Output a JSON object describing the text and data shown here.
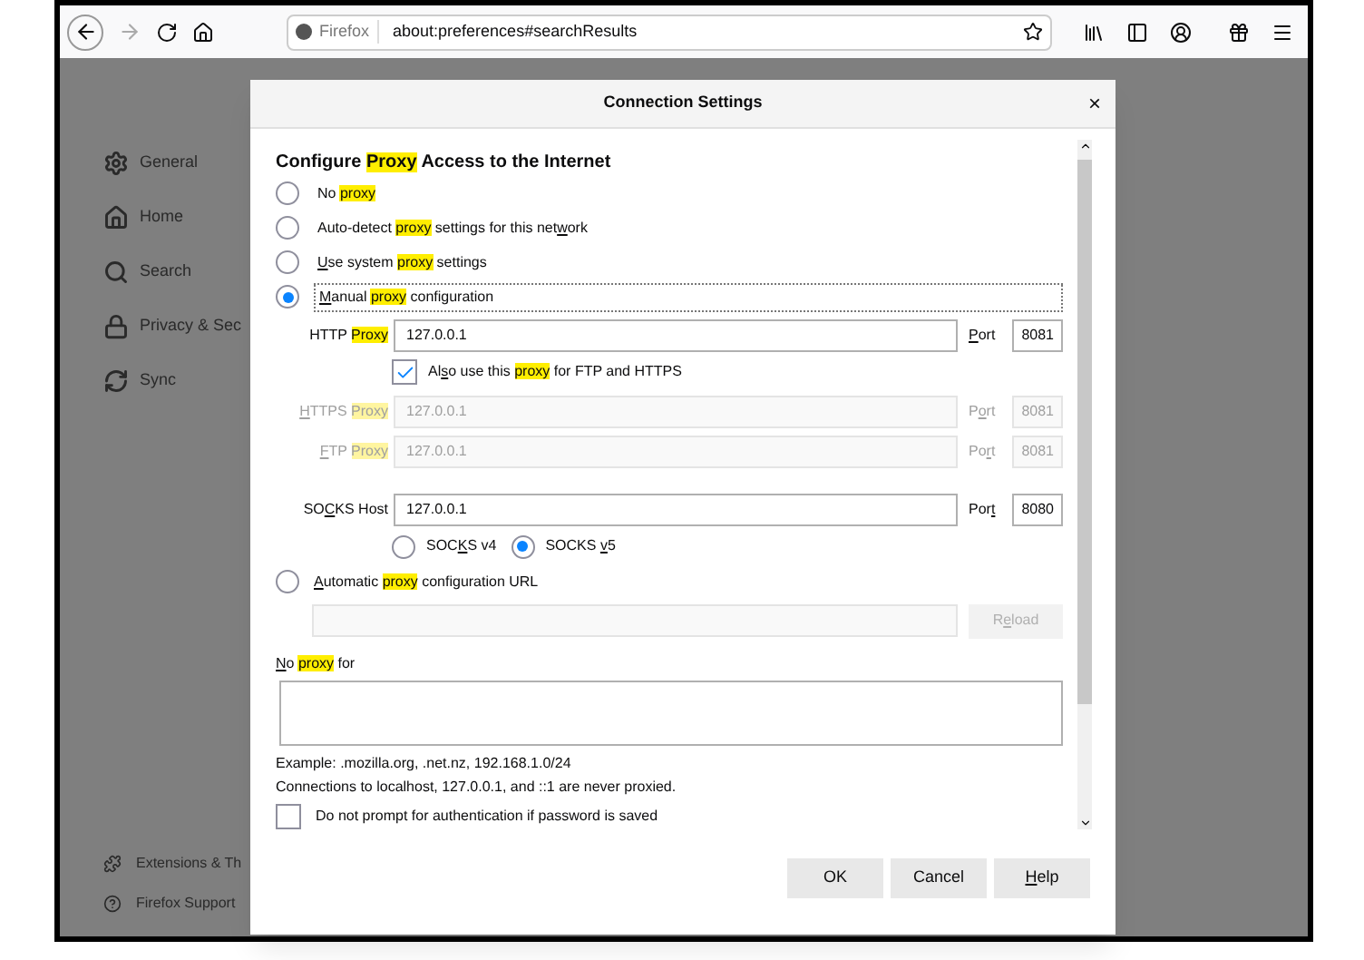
{
  "toolbar": {
    "identity": "Firefox",
    "url": "about:preferences#searchResults"
  },
  "sidebar": {
    "items": [
      {
        "label": "General"
      },
      {
        "label": "Home"
      },
      {
        "label": "Search"
      },
      {
        "label": "Privacy & Sec"
      },
      {
        "label": "Sync"
      }
    ],
    "footer": [
      {
        "label": "Extensions & Th"
      },
      {
        "label": "Firefox Support"
      }
    ]
  },
  "dialog": {
    "title": "Connection Settings",
    "close": "×",
    "heading": [
      {
        "text": "Configure "
      },
      {
        "text": "Proxy",
        "highlight": true
      },
      {
        "text": " Access to the Internet"
      }
    ],
    "modes": [
      {
        "label": [
          {
            "text": "No "
          },
          {
            "text": "proxy",
            "highlight": true
          }
        ],
        "selected": false,
        "focused": false
      },
      {
        "label": [
          {
            "text": "Auto-detect "
          },
          {
            "text": "proxy",
            "highlight": true
          },
          {
            "text": " settings for this net"
          },
          {
            "text": "w",
            "underline": true
          },
          {
            "text": "ork"
          }
        ],
        "selected": false,
        "focused": false
      },
      {
        "label": [
          {
            "text": "U",
            "underline": true
          },
          {
            "text": "se system "
          },
          {
            "text": "proxy",
            "highlight": true
          },
          {
            "text": " settings"
          }
        ],
        "selected": false,
        "focused": false
      },
      {
        "label": [
          {
            "text": "M",
            "underline": true
          },
          {
            "text": "anual "
          },
          {
            "text": "proxy",
            "highlight": true
          },
          {
            "text": " configuration"
          }
        ],
        "selected": true,
        "focused": true
      }
    ],
    "proxies": [
      {
        "kind": "field",
        "label": [
          {
            "text": "HTTP "
          },
          {
            "text": "Proxy",
            "highlight": true
          }
        ],
        "value": "127.0.0.1",
        "port_label": [
          {
            "text": "P",
            "underline": true
          },
          {
            "text": "ort"
          }
        ],
        "port": "8081",
        "disabled": false
      },
      {
        "kind": "checkbox",
        "label": [
          {
            "text": "Al"
          },
          {
            "text": "s",
            "underline": true
          },
          {
            "text": "o use this "
          },
          {
            "text": "proxy",
            "highlight": true
          },
          {
            "text": " for FTP and HTTPS"
          }
        ],
        "checked": true
      },
      {
        "kind": "field",
        "label": [
          {
            "text": "H",
            "underline": true
          },
          {
            "text": "TTPS "
          },
          {
            "text": "Proxy",
            "highlight": true
          }
        ],
        "value": "127.0.0.1",
        "port_label": [
          {
            "text": "P"
          },
          {
            "text": "o",
            "underline": true
          },
          {
            "text": "rt"
          }
        ],
        "port": "8081",
        "disabled": true
      },
      {
        "kind": "field",
        "label": [
          {
            "text": "F",
            "underline": true
          },
          {
            "text": "TP "
          },
          {
            "text": "Proxy",
            "highlight": true
          }
        ],
        "value": "127.0.0.1",
        "port_label": [
          {
            "text": "Po"
          },
          {
            "text": "r",
            "underline": true
          },
          {
            "text": "t"
          }
        ],
        "port": "8081",
        "disabled": true
      },
      {
        "kind": "field",
        "label": [
          {
            "text": "SO"
          },
          {
            "text": "C",
            "underline": true
          },
          {
            "text": "KS Host"
          }
        ],
        "value": "127.0.0.1",
        "port_label": [
          {
            "text": "Por"
          },
          {
            "text": "t",
            "underline": true
          }
        ],
        "port": "8080",
        "disabled": false
      }
    ],
    "socks_versions": [
      {
        "label": [
          {
            "text": "SOC"
          },
          {
            "text": "K",
            "underline": true
          },
          {
            "text": "S v4"
          }
        ],
        "selected": false
      },
      {
        "label": [
          {
            "text": "SOCKS "
          },
          {
            "text": "v",
            "underline": true
          },
          {
            "text": "5"
          }
        ],
        "selected": true
      }
    ],
    "auto_config": {
      "label": [
        {
          "text": "A",
          "underline": true
        },
        {
          "text": "utomatic "
        },
        {
          "text": "proxy",
          "highlight": true
        },
        {
          "text": " configuration URL"
        }
      ],
      "selected": false,
      "reload": [
        {
          "text": "R"
        },
        {
          "text": "e",
          "underline": true
        },
        {
          "text": "load"
        }
      ],
      "reload_disabled": true
    },
    "no_proxy_label": [
      {
        "text": "N",
        "underline": true
      },
      {
        "text": "o "
      },
      {
        "text": "proxy",
        "highlight": true
      },
      {
        "text": " for"
      }
    ],
    "example": "Example: .mozilla.org, .net.nz, 192.168.1.0/24",
    "note": "Connections to localhost, 127.0.0.1, and ::1 are never proxied.",
    "auth": {
      "label": "Do not prompt for authentication if password is saved",
      "checked": false
    },
    "buttons": [
      [
        {
          "text": "OK"
        }
      ],
      [
        {
          "text": "Cancel"
        }
      ],
      [
        {
          "text": "H",
          "underline": true
        },
        {
          "text": "elp"
        }
      ]
    ]
  }
}
